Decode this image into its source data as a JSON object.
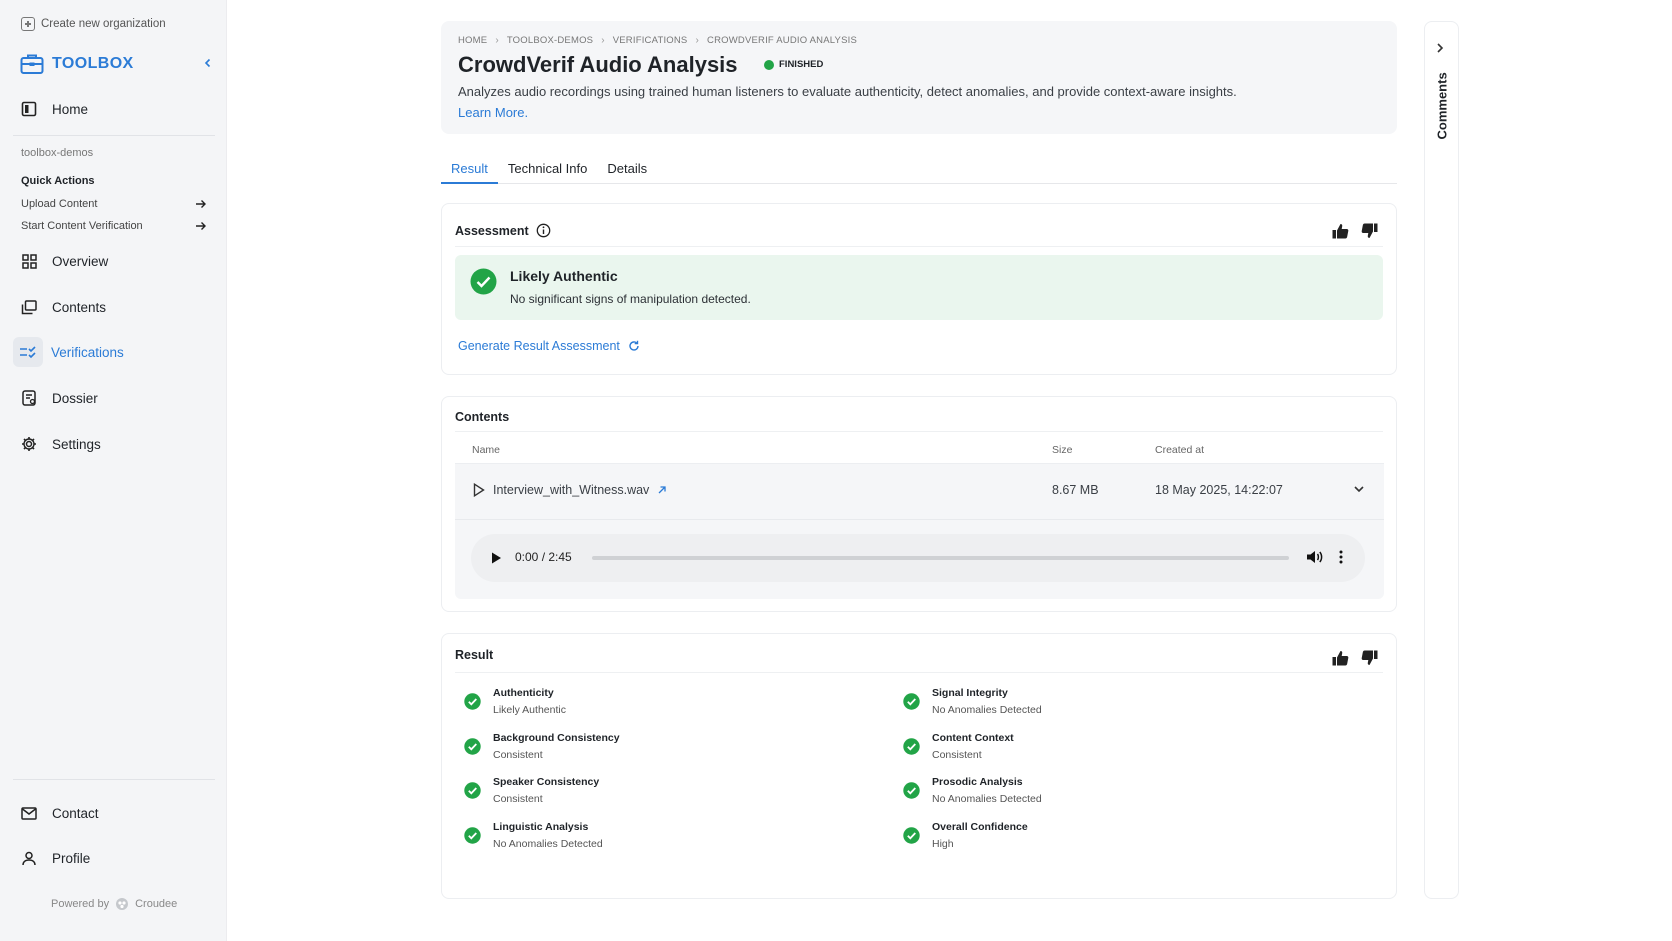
{
  "sidebar": {
    "create_org": "Create new organization",
    "brand": "TOOLBOX",
    "home": "Home",
    "org_name": "toolbox-demos",
    "quick_actions_title": "Quick Actions",
    "quick_actions": [
      "Upload Content",
      "Start Content Verification"
    ],
    "nav": [
      "Overview",
      "Contents",
      "Verifications",
      "Dossier",
      "Settings"
    ],
    "contact": "Contact",
    "profile": "Profile",
    "powered_by": "Powered by",
    "powered_brand": "Croudee"
  },
  "header": {
    "breadcrumb": [
      "HOME",
      "TOOLBOX-DEMOS",
      "VERIFICATIONS",
      "CROWDVERIF AUDIO ANALYSIS"
    ],
    "title": "CrowdVerif Audio Analysis",
    "status": "FINISHED",
    "description": "Analyzes audio recordings using trained human listeners to evaluate authenticity, detect anomalies, and provide context-aware insights.",
    "learn_more": "Learn More."
  },
  "tabs": [
    "Result",
    "Technical Info",
    "Details"
  ],
  "assessment": {
    "title": "Assessment",
    "verdict": "Likely Authentic",
    "summary": "No significant signs of manipulation detected.",
    "generate_link": "Generate Result Assessment"
  },
  "contents": {
    "title": "Contents",
    "columns": [
      "Name",
      "Size",
      "Created at"
    ],
    "file": {
      "name": "Interview_with_Witness.wav",
      "size": "8.67 MB",
      "created": "18 May 2025, 14:22:07"
    },
    "player": {
      "time": "0:00 / 2:45"
    }
  },
  "result": {
    "title": "Result",
    "items": [
      {
        "label": "Authenticity",
        "value": "Likely Authentic"
      },
      {
        "label": "Signal Integrity",
        "value": "No Anomalies Detected"
      },
      {
        "label": "Background Consistency",
        "value": "Consistent"
      },
      {
        "label": "Content Context",
        "value": "Consistent"
      },
      {
        "label": "Speaker Consistency",
        "value": "Consistent"
      },
      {
        "label": "Prosodic Analysis",
        "value": "No Anomalies Detected"
      },
      {
        "label": "Linguistic Analysis",
        "value": "No Anomalies Detected"
      },
      {
        "label": "Overall Confidence",
        "value": "High"
      }
    ]
  },
  "comments": {
    "label": "Comments"
  },
  "colors": {
    "accent": "#2b7bd6",
    "success": "#22a447",
    "success_bg": "#eaf6ee"
  }
}
